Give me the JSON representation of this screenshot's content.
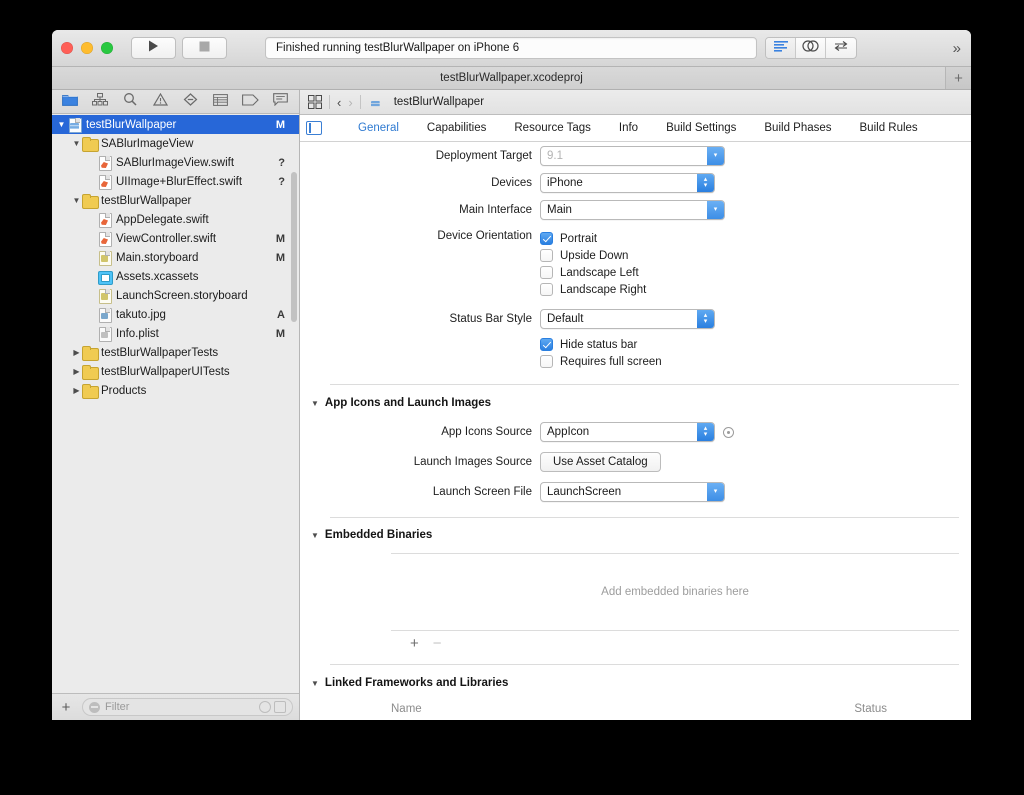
{
  "window": {
    "status_text": "Finished running testBlurWallpaper on iPhone 6",
    "project_tab_title": "testBlurWallpaper.xcodeproj",
    "traffic_lights": [
      "close-button",
      "minimize-button",
      "zoom-button"
    ],
    "run_button": "run-icon",
    "stop_button": "stop-icon",
    "overflow_label": "»",
    "add_tab_label": "+"
  },
  "navigator": {
    "tabs": [
      {
        "name": "project-navigator",
        "icon": "folder-icon",
        "active": true
      },
      {
        "name": "symbol-navigator",
        "icon": "hierarchy-icon",
        "active": false
      },
      {
        "name": "find-navigator",
        "icon": "search-icon",
        "active": false
      },
      {
        "name": "issue-navigator",
        "icon": "warning-icon",
        "active": false
      },
      {
        "name": "test-navigator",
        "icon": "diamond-icon",
        "active": false
      },
      {
        "name": "debug-navigator",
        "icon": "list-icon",
        "active": false
      },
      {
        "name": "breakpoint-navigator",
        "icon": "tag-icon",
        "active": false
      },
      {
        "name": "report-navigator",
        "icon": "message-icon",
        "active": false
      }
    ],
    "tree": [
      {
        "label": "testBlurWallpaper",
        "indent": 0,
        "twisty": "open",
        "icon": "proj",
        "badge": "M",
        "selected": true
      },
      {
        "label": "SABlurImageView",
        "indent": 1,
        "twisty": "open",
        "icon": "folder",
        "badge": ""
      },
      {
        "label": "SABlurImageView.swift",
        "indent": 2,
        "twisty": "none",
        "icon": "swift",
        "badge": "?"
      },
      {
        "label": "UIImage+BlurEffect.swift",
        "indent": 2,
        "twisty": "none",
        "icon": "swift",
        "badge": "?"
      },
      {
        "label": "testBlurWallpaper",
        "indent": 1,
        "twisty": "open",
        "icon": "folder",
        "badge": ""
      },
      {
        "label": "AppDelegate.swift",
        "indent": 2,
        "twisty": "none",
        "icon": "swift",
        "badge": ""
      },
      {
        "label": "ViewController.swift",
        "indent": 2,
        "twisty": "none",
        "icon": "swift",
        "badge": "M"
      },
      {
        "label": "Main.storyboard",
        "indent": 2,
        "twisty": "none",
        "icon": "sb",
        "badge": "M"
      },
      {
        "label": "Assets.xcassets",
        "indent": 2,
        "twisty": "none",
        "icon": "assets",
        "badge": ""
      },
      {
        "label": "LaunchScreen.storyboard",
        "indent": 2,
        "twisty": "none",
        "icon": "sb",
        "badge": ""
      },
      {
        "label": "takuto.jpg",
        "indent": 2,
        "twisty": "none",
        "icon": "img",
        "badge": "A"
      },
      {
        "label": "Info.plist",
        "indent": 2,
        "twisty": "none",
        "icon": "plist",
        "badge": "M"
      },
      {
        "label": "testBlurWallpaperTests",
        "indent": 1,
        "twisty": "closed",
        "icon": "folder",
        "badge": ""
      },
      {
        "label": "testBlurWallpaperUITests",
        "indent": 1,
        "twisty": "closed",
        "icon": "folder",
        "badge": ""
      },
      {
        "label": "Products",
        "indent": 1,
        "twisty": "closed",
        "icon": "folder",
        "badge": ""
      }
    ],
    "footer": {
      "add_label": "+",
      "filter_placeholder": "Filter",
      "recent_icon": "clock-icon",
      "source_control_icon": "source-control-icon"
    }
  },
  "jumpbar": {
    "related_items_icon": "grid-icon",
    "back_arrow": "‹",
    "forward_arrow": "›",
    "path_label": "testBlurWallpaper"
  },
  "inspector_tabs": [
    {
      "label": "General",
      "active": true
    },
    {
      "label": "Capabilities",
      "active": false
    },
    {
      "label": "Resource Tags",
      "active": false
    },
    {
      "label": "Info",
      "active": false
    },
    {
      "label": "Build Settings",
      "active": false
    },
    {
      "label": "Build Phases",
      "active": false
    },
    {
      "label": "Build Rules",
      "active": false
    }
  ],
  "deployment_info": {
    "deployment_target": {
      "label": "Deployment Target",
      "value": "9.1",
      "dimmed": true
    },
    "devices": {
      "label": "Devices",
      "value": "iPhone"
    },
    "main_interface": {
      "label": "Main Interface",
      "value": "Main"
    },
    "device_orientation": {
      "label": "Device Orientation",
      "options": [
        {
          "label": "Portrait",
          "checked": true
        },
        {
          "label": "Upside Down",
          "checked": false
        },
        {
          "label": "Landscape Left",
          "checked": false
        },
        {
          "label": "Landscape Right",
          "checked": false
        }
      ]
    },
    "status_bar_style": {
      "label": "Status Bar Style",
      "value": "Default"
    },
    "status_bar_options": [
      {
        "label": "Hide status bar",
        "checked": true
      },
      {
        "label": "Requires full screen",
        "checked": false
      }
    ]
  },
  "app_icons_section": {
    "title": "App Icons and Launch Images",
    "app_icons_source": {
      "label": "App Icons Source",
      "value": "AppIcon"
    },
    "launch_images_source": {
      "label": "Launch Images Source",
      "button": "Use Asset Catalog"
    },
    "launch_screen_file": {
      "label": "Launch Screen File",
      "value": "LaunchScreen"
    }
  },
  "embedded_binaries": {
    "title": "Embedded Binaries",
    "empty_text": "Add embedded binaries here",
    "add_label": "+",
    "remove_label": "−"
  },
  "linked_frameworks": {
    "title": "Linked Frameworks and Libraries",
    "columns": [
      "Name",
      "Status"
    ]
  },
  "colors": {
    "selection_blue": "#2767d8",
    "accent_blue": "#2f7ad1",
    "control_blue": "#2a7fe0",
    "swift_orange": "#e8663a",
    "folder_yellow": "#f0cb52"
  }
}
